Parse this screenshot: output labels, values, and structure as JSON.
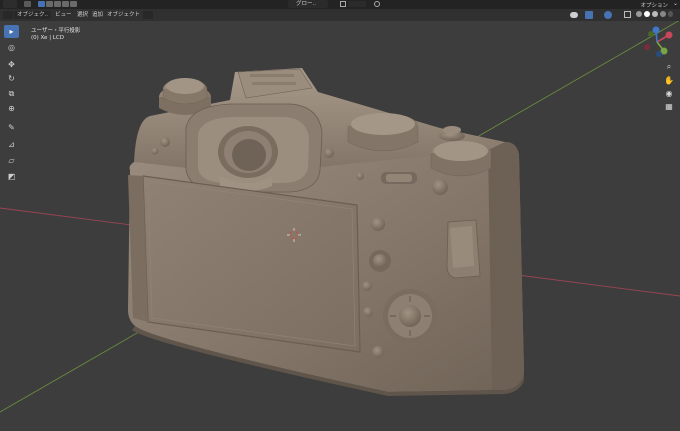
{
  "header": {
    "options_label": "オプション",
    "caret": "⌄",
    "orientation_label": "グロー..",
    "mode_icons": [
      "select-box-icon",
      "mode-new-icon",
      "mode-extend-icon",
      "mode-subtract-icon",
      "mode-invert-icon"
    ]
  },
  "menu": {
    "mode": "オブジェク..",
    "view": "ビュー",
    "select": "選択",
    "add": "追加",
    "object": "オブジェクト"
  },
  "overlay": {
    "view_name": "ユーザー・平行投影",
    "collection": "(0) Xe | LCD"
  },
  "toolbar": [
    "select-tool-icon",
    "cursor-tool-icon",
    "move-tool-icon",
    "rotate-tool-icon",
    "scale-tool-icon",
    "transform-tool-icon",
    "annotate-tool-icon",
    "measure-tool-icon",
    "add-cube-tool-icon"
  ],
  "gizmo": {
    "x": "X",
    "y": "Y",
    "z": "Z"
  },
  "colors": {
    "accent": "#4772b3",
    "viewport": "#3d3d3d",
    "header": "#303030",
    "model": "#8a7d70",
    "axis_x": "#c7465a",
    "axis_y": "#7aa544",
    "axis_z": "#3f78c9"
  }
}
